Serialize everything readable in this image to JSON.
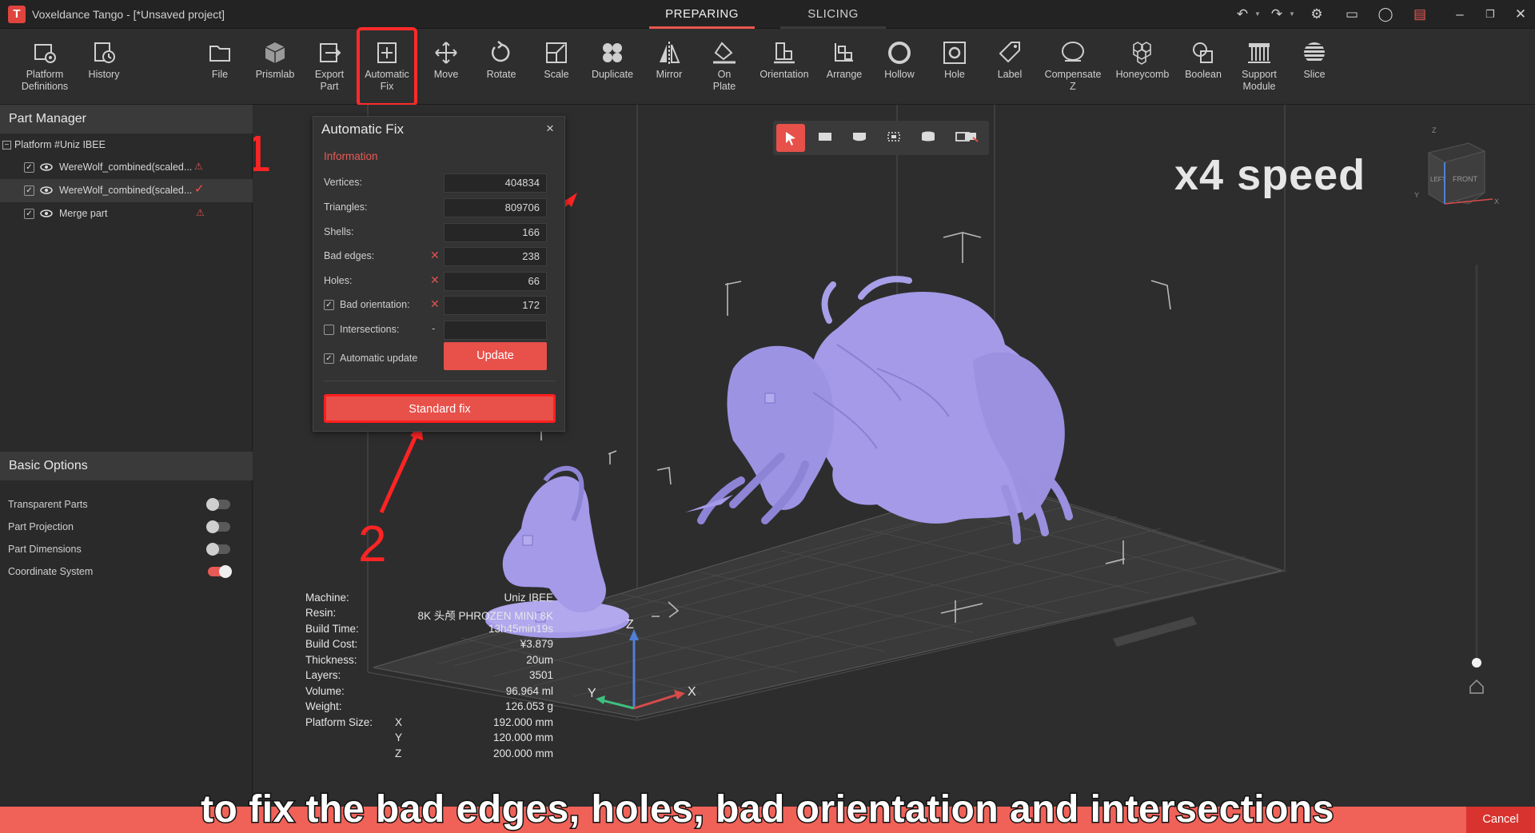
{
  "window": {
    "title": "Voxeldance Tango - [*Unsaved project]",
    "tabs": [
      "PREPARING",
      "SLICING"
    ]
  },
  "toolbar": {
    "tools": [
      {
        "id": "platform-definitions",
        "label": "Platform\nDefinitions"
      },
      {
        "id": "history",
        "label": "History"
      },
      {
        "id": "file",
        "label": "File"
      },
      {
        "id": "prismlab",
        "label": "Prismlab"
      },
      {
        "id": "export-part",
        "label": "Export\nPart"
      },
      {
        "id": "automatic-fix",
        "label": "Automatic\nFix"
      },
      {
        "id": "move",
        "label": "Move"
      },
      {
        "id": "rotate",
        "label": "Rotate"
      },
      {
        "id": "scale",
        "label": "Scale"
      },
      {
        "id": "duplicate",
        "label": "Duplicate"
      },
      {
        "id": "mirror",
        "label": "Mirror"
      },
      {
        "id": "on-plate",
        "label": "On\nPlate"
      },
      {
        "id": "orientation",
        "label": "Orientation"
      },
      {
        "id": "arrange",
        "label": "Arrange"
      },
      {
        "id": "hollow",
        "label": "Hollow"
      },
      {
        "id": "hole",
        "label": "Hole"
      },
      {
        "id": "label",
        "label": "Label"
      },
      {
        "id": "compensate-z",
        "label": "Compensate\nZ"
      },
      {
        "id": "honeycomb",
        "label": "Honeycomb"
      },
      {
        "id": "boolean",
        "label": "Boolean"
      },
      {
        "id": "support-module",
        "label": "Support\nModule"
      },
      {
        "id": "slice",
        "label": "Slice"
      }
    ]
  },
  "part_manager": {
    "title": "Part Manager",
    "platform": "Platform #Uniz IBEE",
    "parts": [
      {
        "name": "WereWolf_combined(scaled...",
        "status": "warning"
      },
      {
        "name": "WereWolf_combined(scaled...",
        "status": "ok"
      },
      {
        "name": "Merge part",
        "status": "warning"
      }
    ]
  },
  "basic_options": {
    "title": "Basic Options",
    "items": [
      {
        "label": "Transparent Parts",
        "on": false
      },
      {
        "label": "Part Projection",
        "on": false
      },
      {
        "label": "Part Dimensions",
        "on": false
      },
      {
        "label": "Coordinate System",
        "on": true
      }
    ]
  },
  "fix_dialog": {
    "title": "Automatic Fix",
    "section": "Information",
    "vertices_label": "Vertices:",
    "vertices": "404834",
    "triangles_label": "Triangles:",
    "triangles": "809706",
    "shells_label": "Shells:",
    "shells": "166",
    "bad_edges_label": "Bad edges:",
    "bad_edges": "238",
    "holes_label": "Holes:",
    "holes": "66",
    "bad_orientation_label": "Bad orientation:",
    "bad_orientation": "172",
    "intersections_label": "Intersections:",
    "intersections": "",
    "intersections_mark": "-",
    "auto_update_label": "Automatic update",
    "update_button": "Update",
    "standard_fix_button": "Standard fix"
  },
  "overlay": {
    "speed": "x4 speed",
    "annotation_1": "1",
    "annotation_2": "2",
    "subtitle": "to fix the bad edges, holes, bad orientation and intersections"
  },
  "axes": {
    "x": "X",
    "y": "Y",
    "z": "Z"
  },
  "view_cube": {
    "left": "LEFT",
    "front": "FRONT"
  },
  "info": {
    "machine_label": "Machine:",
    "machine": "Uniz IBEE",
    "resin_label": "Resin:",
    "resin": "8K 头颅 PHROZEN MINI 8K",
    "build_time_label": "Build Time:",
    "build_time": "13h45min19s",
    "build_cost_label": "Build Cost:",
    "build_cost": "¥3.879",
    "thickness_label": "Thickness:",
    "thickness": "20um",
    "layers_label": "Layers:",
    "layers": "3501",
    "volume_label": "Volume:",
    "volume": "96.964 ml",
    "weight_label": "Weight:",
    "weight": "126.053 g",
    "platform_size_label": "Platform Size:",
    "x_label": "X",
    "x": "192.000 mm",
    "y_label": "Y",
    "y": "120.000 mm",
    "z_label": "Z",
    "z": "200.000 mm"
  },
  "bottom": {
    "cancel": "Cancel"
  },
  "colors": {
    "accent": "#e8504a",
    "highlight": "#ff2424",
    "model": "#a49ae8"
  }
}
